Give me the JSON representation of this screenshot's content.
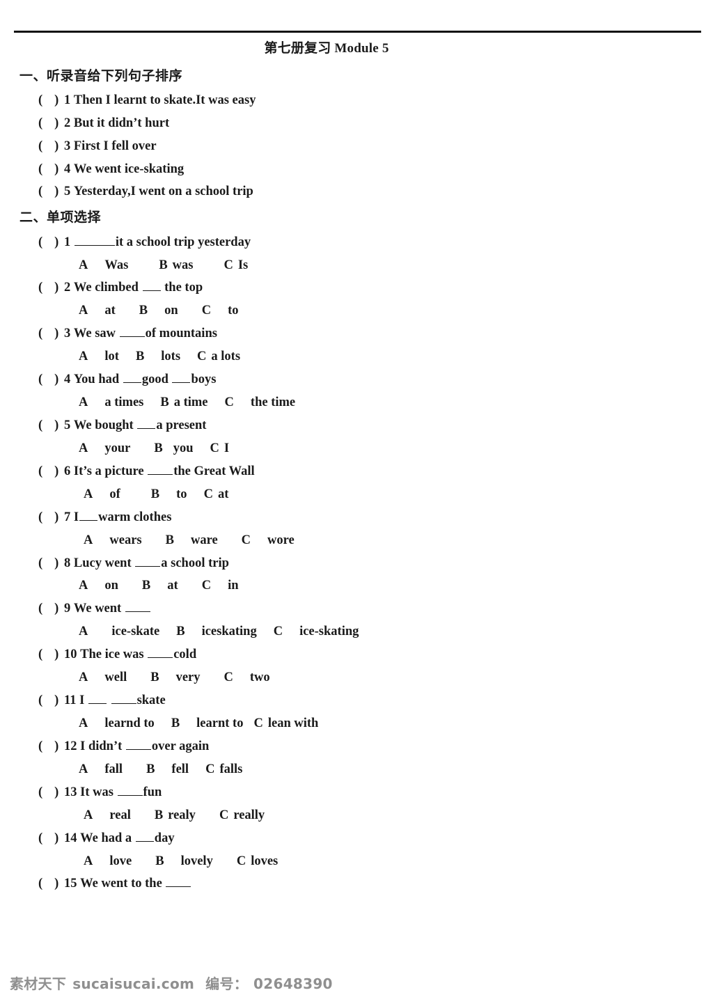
{
  "document": {
    "title": "第七册复习 Module 5"
  },
  "sections": [
    {
      "heading": "一、听录音给下列句子排序",
      "questions": [
        {
          "paren": "(",
          "paren_close": ")",
          "num": "1",
          "text": "Then I learnt to skate.It was easy"
        },
        {
          "paren": "(",
          "paren_close": ")",
          "num": "2",
          "text": "But it didn’t hurt"
        },
        {
          "paren": "(",
          "paren_close": ")",
          "num": "3",
          "text": "First I fell over"
        },
        {
          "paren": "(",
          "paren_close": ")",
          "num": "4",
          "text": "We went ice-skating"
        },
        {
          "paren": "(",
          "paren_close": ")",
          "num": "5",
          "text": "Yesterday,I went on a school trip"
        }
      ]
    },
    {
      "heading": "二、单项选择",
      "questions": [
        {
          "num": "1",
          "pre": "",
          "post": "it a school trip yesterday",
          "options": [
            {
              "letter": "A",
              "value": "Was"
            },
            {
              "letter": "B",
              "value": "was"
            },
            {
              "letter": "C",
              "value": "Is"
            }
          ]
        },
        {
          "num": "2",
          "pre": "We climbed",
          "post": "the top",
          "options": [
            {
              "letter": "A",
              "value": "at"
            },
            {
              "letter": "B",
              "value": "on"
            },
            {
              "letter": "C",
              "value": "to"
            }
          ]
        },
        {
          "num": "3",
          "pre": "We saw",
          "post": "of mountains",
          "options": [
            {
              "letter": "A",
              "value": "lot"
            },
            {
              "letter": "B",
              "value": "lots"
            },
            {
              "letter": "C",
              "value": "a lots"
            }
          ]
        },
        {
          "num": "4",
          "pre": "You had",
          "mid": "good",
          "post": "boys",
          "options": [
            {
              "letter": "A",
              "value": "a    times"
            },
            {
              "letter": "B",
              "value": "a    time"
            },
            {
              "letter": "C",
              "value": "the    time"
            }
          ]
        },
        {
          "num": "5",
          "pre": "We bought",
          "post": "a present",
          "options": [
            {
              "letter": "A",
              "value": "your"
            },
            {
              "letter": "B",
              "value": "you"
            },
            {
              "letter": "C",
              "value": "I"
            }
          ]
        },
        {
          "num": "6",
          "pre": "It’s a picture",
          "post": "the Great Wall",
          "options": [
            {
              "letter": "A",
              "value": "of"
            },
            {
              "letter": "B",
              "value": "to"
            },
            {
              "letter": "C",
              "value": "at"
            }
          ]
        },
        {
          "num": "7",
          "pre": "I",
          "post": "warm clothes",
          "options": [
            {
              "letter": "A",
              "value": "wears"
            },
            {
              "letter": "B",
              "value": "ware"
            },
            {
              "letter": "C",
              "value": "wore"
            }
          ]
        },
        {
          "num": "8",
          "pre": "Lucy went",
          "post": "a school trip",
          "options": [
            {
              "letter": "A",
              "value": "on"
            },
            {
              "letter": "B",
              "value": "at"
            },
            {
              "letter": "C",
              "value": "in"
            }
          ]
        },
        {
          "num": "9",
          "pre": "We went",
          "post": "",
          "options": [
            {
              "letter": "A",
              "value": "ice-skate"
            },
            {
              "letter": "B",
              "value": "iceskating"
            },
            {
              "letter": "C",
              "value": "ice-skating"
            }
          ]
        },
        {
          "num": "10",
          "pre": "The ice was",
          "post": "cold",
          "options": [
            {
              "letter": "A",
              "value": "well"
            },
            {
              "letter": "B",
              "value": "very"
            },
            {
              "letter": "C",
              "value": "two"
            }
          ]
        },
        {
          "num": "11",
          "pre": "I",
          "mid": "",
          "post": "skate",
          "options": [
            {
              "letter": "A",
              "value": "learnd    to"
            },
            {
              "letter": "B",
              "value": "learnt   to"
            },
            {
              "letter": "C",
              "value": "lean    with"
            }
          ]
        },
        {
          "num": "12",
          "pre": "I didn’t",
          "post": "over again",
          "options": [
            {
              "letter": "A",
              "value": "fall"
            },
            {
              "letter": "B",
              "value": "fell"
            },
            {
              "letter": "C",
              "value": "falls"
            }
          ]
        },
        {
          "num": "13",
          "pre": "It was",
          "post": "fun",
          "options": [
            {
              "letter": "A",
              "value": "real"
            },
            {
              "letter": "B",
              "value": "realy"
            },
            {
              "letter": "C",
              "value": "really"
            }
          ]
        },
        {
          "num": "14",
          "pre": "We had a",
          "post": "day",
          "options": [
            {
              "letter": "A",
              "value": "love"
            },
            {
              "letter": "B",
              "value": "lovely"
            },
            {
              "letter": "C",
              "value": "loves"
            }
          ]
        },
        {
          "num": "15",
          "pre": "We went to the",
          "post": "",
          "options": []
        }
      ]
    }
  ],
  "footer": {
    "brand": "素材天下",
    "site": "sucaisucai.com",
    "id_label": "编号：",
    "id_value": "02648390"
  }
}
